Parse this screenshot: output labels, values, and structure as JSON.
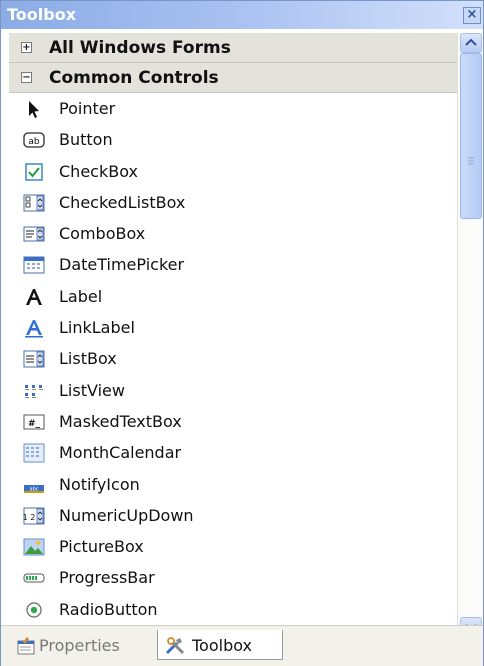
{
  "window": {
    "title": "Toolbox",
    "close_glyph": "×"
  },
  "categories": [
    {
      "label": "All Windows Forms",
      "toggle": "+"
    },
    {
      "label": "Common Controls",
      "toggle": "−"
    }
  ],
  "items": [
    {
      "label": "Pointer",
      "icon": "pointer-icon"
    },
    {
      "label": "Button",
      "icon": "button-icon"
    },
    {
      "label": "CheckBox",
      "icon": "checkbox-icon"
    },
    {
      "label": "CheckedListBox",
      "icon": "checkedlistbox-icon"
    },
    {
      "label": "ComboBox",
      "icon": "combobox-icon"
    },
    {
      "label": "DateTimePicker",
      "icon": "datetimepicker-icon"
    },
    {
      "label": "Label",
      "icon": "label-icon"
    },
    {
      "label": "LinkLabel",
      "icon": "linklabel-icon"
    },
    {
      "label": "ListBox",
      "icon": "listbox-icon"
    },
    {
      "label": "ListView",
      "icon": "listview-icon"
    },
    {
      "label": "MaskedTextBox",
      "icon": "maskedtextbox-icon"
    },
    {
      "label": "MonthCalendar",
      "icon": "monthcalendar-icon"
    },
    {
      "label": "NotifyIcon",
      "icon": "notifyicon-icon"
    },
    {
      "label": "NumericUpDown",
      "icon": "numericupdown-icon"
    },
    {
      "label": "PictureBox",
      "icon": "picturebox-icon"
    },
    {
      "label": "ProgressBar",
      "icon": "progressbar-icon"
    },
    {
      "label": "RadioButton",
      "icon": "radiobutton-icon"
    }
  ],
  "icon_text": {
    "button": "ab",
    "masked": "#_",
    "numeric": "1 2",
    "notify": "abc"
  },
  "tabs": [
    {
      "label": "Properties",
      "icon": "properties-icon",
      "selected": false
    },
    {
      "label": "Toolbox",
      "icon": "toolbox-icon",
      "selected": true
    }
  ],
  "colors": {
    "title_bar": "#a6bff0",
    "category_bg": "#e3e3dc",
    "accent_blue": "#2f6fd1"
  }
}
